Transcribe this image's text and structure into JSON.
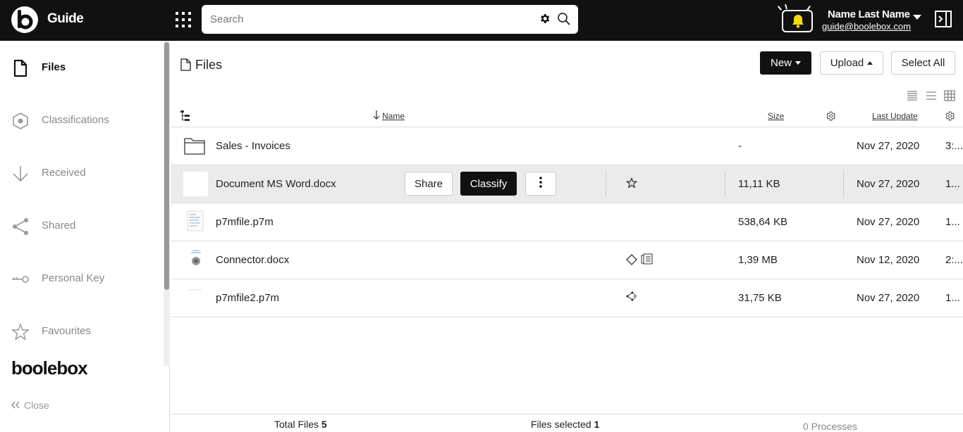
{
  "header": {
    "app_title": "Guide",
    "search_placeholder": "Search",
    "user_name": "Name Last Name",
    "user_email": "guide@boolebox.com"
  },
  "sidebar": {
    "items": [
      {
        "label": "Files",
        "icon": "file-icon",
        "active": true
      },
      {
        "label": "Classifications",
        "icon": "hexagon-icon"
      },
      {
        "label": "Received",
        "icon": "arrow-down-icon"
      },
      {
        "label": "Shared",
        "icon": "share-icon"
      },
      {
        "label": "Personal Key",
        "icon": "key-icon"
      },
      {
        "label": "Favourites",
        "icon": "star-icon"
      }
    ],
    "brand": "boolebox",
    "close_label": "Close"
  },
  "main": {
    "title": "Files",
    "buttons": {
      "new": "New",
      "upload": "Upload",
      "select_all": "Select All"
    },
    "columns": {
      "name": "Name",
      "size": "Size",
      "last_update": "Last Update"
    },
    "rows": [
      {
        "name": "Sales - Invoices",
        "size": "-",
        "date": "Nov 27, 2020",
        "time": "3:...",
        "type": "folder"
      },
      {
        "name": "Document MS Word.docx",
        "size": "11,11 KB",
        "date": "Nov 27, 2020",
        "time": "1...",
        "type": "docx",
        "selected": true
      },
      {
        "name": "p7mfile.p7m",
        "size": "538,64 KB",
        "date": "Nov 27, 2020",
        "time": "1...",
        "type": "p7m"
      },
      {
        "name": "Connector.docx",
        "size": "1,39 MB",
        "date": "Nov 12, 2020",
        "time": "2:...",
        "type": "docx"
      },
      {
        "name": "p7mfile2.p7m",
        "size": "31,75 KB",
        "date": "Nov 27, 2020",
        "time": "1...",
        "type": "p7m"
      }
    ],
    "row_actions": {
      "share": "Share",
      "classify": "Classify"
    },
    "footer": {
      "total_files_label": "Total Files",
      "total_files": "5",
      "files_selected_label": "Files selected",
      "files_selected": "1",
      "processes": "0 Processes"
    }
  },
  "colors": {
    "topbar": "#111111",
    "bell": "#f5d90a",
    "selected_row": "#ebebeb"
  }
}
